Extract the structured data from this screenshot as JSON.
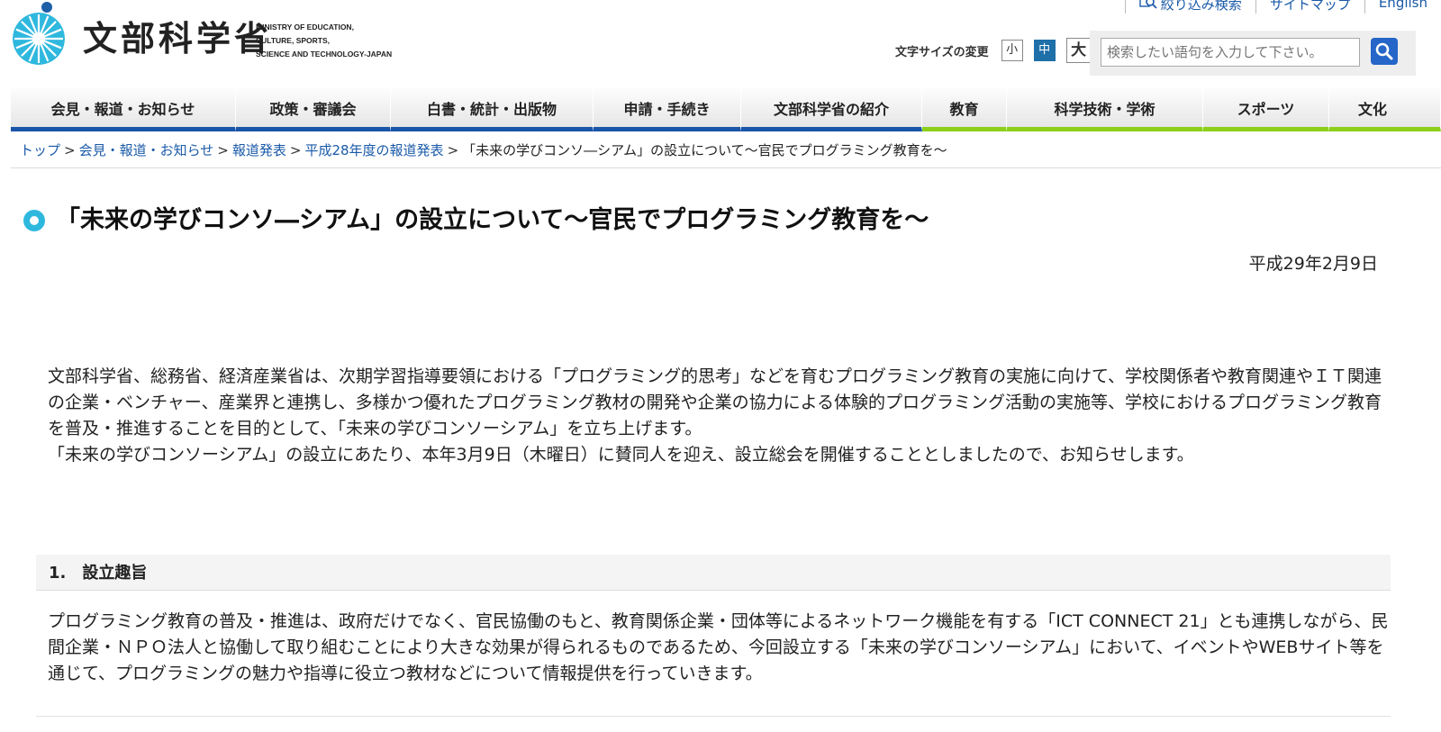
{
  "header": {
    "logo_jp": "文部科学省",
    "logo_en_lines": [
      "MINISTRY OF EDUCATION,",
      "CULTURE, SPORTS,",
      "SCIENCE AND TECHNOLOGY-JAPAN"
    ],
    "utility_links": [
      {
        "label": "絞り込み検索",
        "icon": "search-filter-icon"
      },
      {
        "label": "サイトマップ"
      },
      {
        "label": "English"
      }
    ],
    "font_size_label": "文字サイズの変更",
    "font_size_options": [
      "小",
      "中",
      "大"
    ],
    "font_size_selected": "中",
    "search_placeholder": "検索したい語句を入力して下さい。",
    "colors": {
      "primary": "#1a55a8",
      "accent_green": "#8ccf1a",
      "logo_cyan": "#2fb8de"
    }
  },
  "nav": [
    {
      "label": "会見・報道・お知らせ",
      "group": "blue"
    },
    {
      "label": "政策・審議会",
      "group": "blue"
    },
    {
      "label": "白書・統計・出版物",
      "group": "blue"
    },
    {
      "label": "申請・手続き",
      "group": "blue"
    },
    {
      "label": "文部科学省の紹介",
      "group": "blue"
    },
    {
      "label": "教育",
      "group": "green"
    },
    {
      "label": "科学技術・学術",
      "group": "green"
    },
    {
      "label": "スポーツ",
      "group": "green"
    },
    {
      "label": "文化",
      "group": "green"
    }
  ],
  "breadcrumb": {
    "links": [
      "トップ",
      "会見・報道・お知らせ",
      "報道発表",
      "平成28年度の報道発表"
    ],
    "current": "「未来の学びコンソ―シアム」の設立について〜官民でプログラミング教育を〜",
    "separator": ">"
  },
  "page": {
    "title": "「未来の学びコンソ―シアム」の設立について〜官民でプログラミング教育を〜",
    "date": "平成29年2月9日",
    "intro_paragraphs": [
      "文部科学省、総務省、経済産業省は、次期学習指導要領における「プログラミング的思考」などを育むプログラミング教育の実施に向けて、学校関係者や教育関連やＩＴ関連の企業・ベンチャー、産業界と連携し、多様かつ優れたプログラミング教材の開発や企業の協力による体験的プログラミング活動の実施等、学校におけるプログラミング教育を普及・推進することを目的として、「未来の学びコンソーシアム」を立ち上げます。",
      "「未来の学びコンソーシアム」の設立にあたり、本年3月9日（木曜日）に賛同人を迎え、設立総会を開催することとしましたので、お知らせします。"
    ],
    "section1": {
      "heading": "1.　設立趣旨",
      "body": "プログラミング教育の普及・推進は、政府だけでなく、官民協働のもと、教育関係企業・団体等によるネットワーク機能を有する「ICT CONNECT 21」とも連携しながら、民間企業・ＮＰＯ法人と協働して取り組むことにより大きな効果が得られるものであるため、今回設立する「未来の学びコンソーシアム」において、イベントやWEBサイト等を通じて、プログラミングの魅力や指導に役立つ教材などについて情報提供を行っていきます。"
    }
  }
}
